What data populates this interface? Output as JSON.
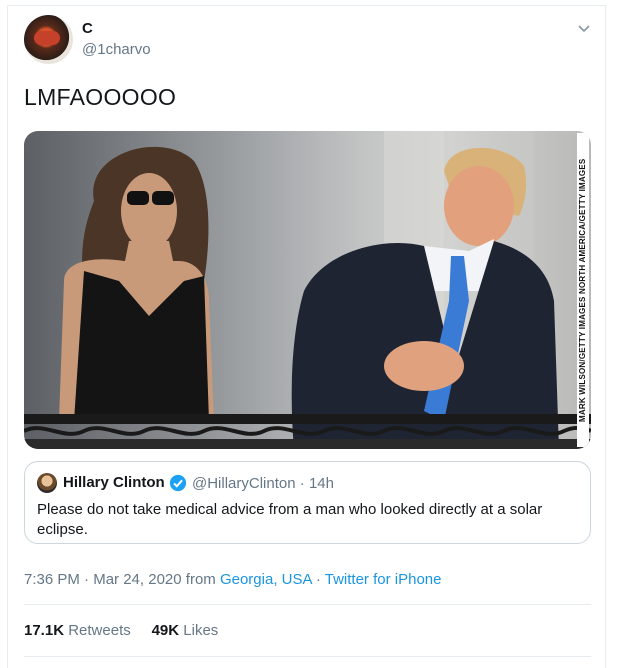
{
  "author": {
    "display_name": "C",
    "handle": "@1charvo"
  },
  "tweet": {
    "text": "LMFAOOOOO"
  },
  "photo": {
    "credit": "MARK WILSON/GETTY IMAGES NORTH AMERICA/GETTY IMAGES"
  },
  "quoted_tweet": {
    "name": "Hillary Clinton",
    "handle": "@HillaryClinton",
    "separator": "·",
    "age": "14h",
    "text": "Please do not take medical advice from a man who looked directly at a solar eclipse."
  },
  "meta": {
    "time": "7:36 PM",
    "dot1": "·",
    "date": "Mar 24, 2020",
    "from_word": "from",
    "location": "Georgia, USA",
    "dot2": "·",
    "client": "Twitter for iPhone"
  },
  "stats": {
    "retweets_count": "17.1K",
    "retweets_label": "Retweets",
    "likes_count": "49K",
    "likes_label": "Likes"
  },
  "icons": {
    "chevron": "chevron-down-icon",
    "verified": "verified-badge-icon"
  },
  "colors": {
    "link": "#1b95e0",
    "secondary_text": "#657786",
    "verified": "#1da1f2"
  }
}
